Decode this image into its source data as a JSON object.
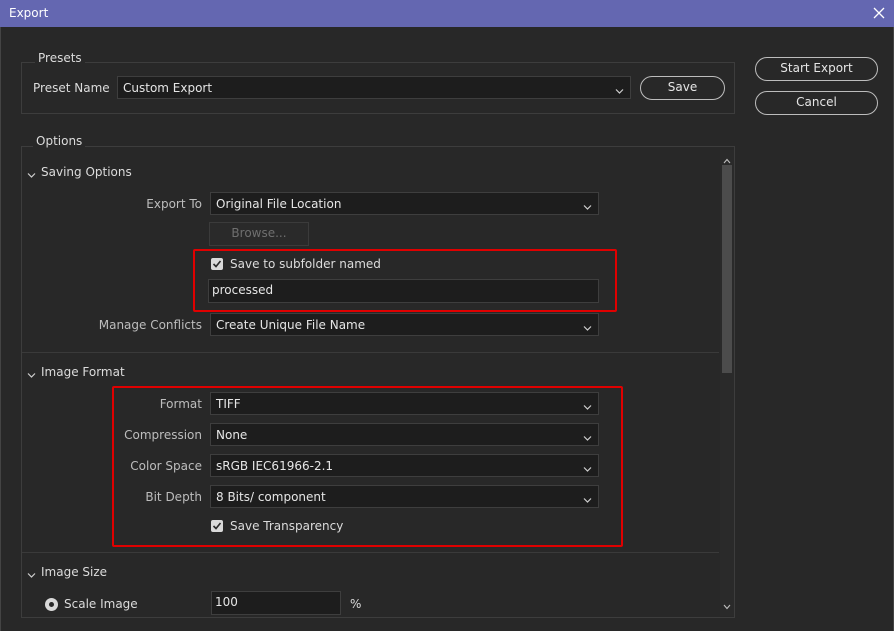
{
  "window": {
    "title": "Export"
  },
  "presets": {
    "legend": "Presets",
    "preset_name_label": "Preset Name",
    "preset_value": "Custom Export",
    "save_button": "Save"
  },
  "actions": {
    "start_export": "Start Export",
    "cancel": "Cancel"
  },
  "options": {
    "legend": "Options"
  },
  "saving_options": {
    "title": "Saving Options",
    "export_to_label": "Export To",
    "export_to_value": "Original File Location",
    "browse_button": "Browse...",
    "subfolder_checkbox_label": "Save to subfolder named",
    "subfolder_checked": true,
    "subfolder_value": "processed",
    "manage_conflicts_label": "Manage Conflicts",
    "manage_conflicts_value": "Create Unique File Name"
  },
  "image_format": {
    "title": "Image Format",
    "format_label": "Format",
    "format_value": "TIFF",
    "compression_label": "Compression",
    "compression_value": "None",
    "color_space_label": "Color Space",
    "color_space_value": "sRGB IEC61966-2.1",
    "bit_depth_label": "Bit Depth",
    "bit_depth_value": "8 Bits/ component",
    "transparency_label": "Save Transparency",
    "transparency_checked": true
  },
  "image_size": {
    "title": "Image Size",
    "scale_label": "Scale Image",
    "scale_value": "100",
    "scale_unit": "%"
  },
  "colors": {
    "titlebar": "#6467b1",
    "highlight": "#e00000",
    "background": "#282828"
  }
}
